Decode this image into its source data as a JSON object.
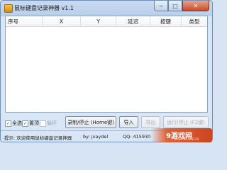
{
  "window": {
    "title": "鼠标键盘记录神器 v1.1",
    "minimize": "−",
    "maximize": "□",
    "close": "✕"
  },
  "table": {
    "columns": [
      "序号",
      "X",
      "Y",
      "延迟",
      "按键",
      "类型"
    ],
    "rows": []
  },
  "controls": {
    "select_all": {
      "label": "全选",
      "checked": true
    },
    "topmost": {
      "label": "置顶",
      "checked": true
    },
    "loop": {
      "label": "循环",
      "checked": false
    },
    "record_button": "录制/停止 (Home键)",
    "import_button": "导入",
    "export_button": "导出",
    "run_button": "运行(停止 (F2键)"
  },
  "status": {
    "message": "提示: 欢迎使用鼠标键盘记录神器",
    "author": "by: jxaydel",
    "qq": "QQ: 415930"
  },
  "watermark": {
    "text": "9游戏网",
    "sub": "WWW.9GAME.CN"
  }
}
